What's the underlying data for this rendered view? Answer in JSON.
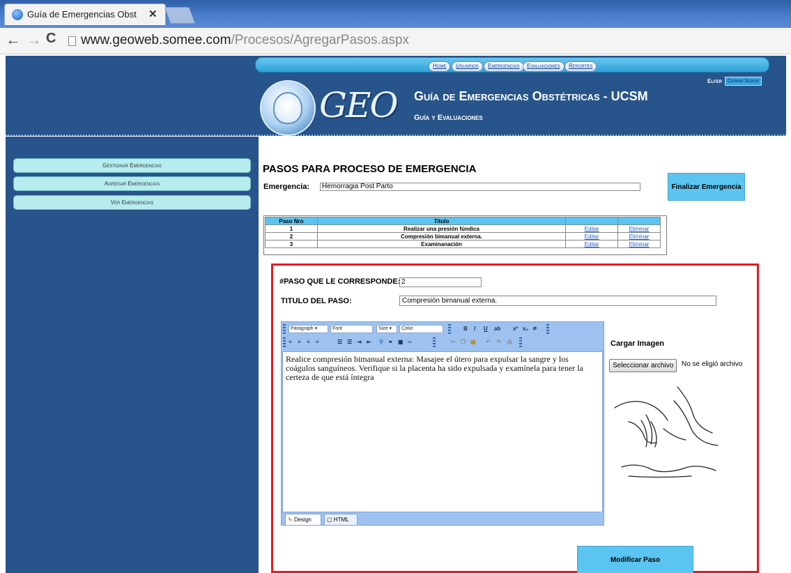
{
  "browser": {
    "tab_title": "Guía de Emergencias Obst",
    "tab_close": "✕",
    "url_host": "www.geoweb.somee.com",
    "url_path": "/Procesos/AgregarPasos.aspx"
  },
  "header": {
    "nav": [
      "Home",
      "Usuarios",
      "Emergencias",
      "Evaluaciones",
      "Reportes"
    ],
    "logo_text": "GEO",
    "title": "Guía de Emergencias Obstétricas - UCSM",
    "subtitle": "Guía y Evaluaciones",
    "user": "Elfer",
    "logout": "Cerrar Sesion"
  },
  "sidebar": {
    "items": [
      "Gestionar Emergencias",
      "Agregar Emergencias",
      "Ver Emergencias"
    ]
  },
  "main": {
    "title": "PASOS PARA PROCESO DE EMERGENCIA",
    "emergency_label": "Emergencia:",
    "emergency_value": "Hemorragia Post Parto",
    "finalize_button": "Finalizar Emergencia",
    "table": {
      "headers": [
        "Paso Nro",
        "Titulo",
        "",
        ""
      ],
      "rows": [
        {
          "num": "1",
          "title": "Realizar una presión fúndica",
          "edit": "Editar",
          "delete": "Eliminar"
        },
        {
          "num": "2",
          "title": "Compresión bimanual externa.",
          "edit": "Editar",
          "delete": "Eliminar"
        },
        {
          "num": "3",
          "title": "Examinanación",
          "edit": "Editar",
          "delete": "Eliminar"
        }
      ]
    }
  },
  "form": {
    "step_number_label": "#PASO QUE LE CORRESPONDE:",
    "step_number_value": "2",
    "step_title_label": "TITULO DEL PASO:",
    "step_title_value": "Compresión bimanual externa.",
    "editor": {
      "paragraph": "Paragraph",
      "font": "Font",
      "size": "Size",
      "color": "Color",
      "content": "Realice compresión bimanual externa: Masajee el útero para expulsar la sangre y los coágulos sanguíneos. Verifique si la placenta ha sido expulsada y examínela para tener la certeza de que está íntegra",
      "tab_design": "Design",
      "tab_html": "HTML"
    },
    "upload_title": "Cargar Imagen",
    "choose_file": "Seleccionar archivo",
    "no_file": "No se eligió archivo",
    "submit": "Modificar Paso"
  },
  "colors": {
    "header_bg": "#27548a",
    "accent": "#5bc4f0",
    "highlight_border": "#e31a22",
    "sidebar_button": "#b6ecee"
  }
}
